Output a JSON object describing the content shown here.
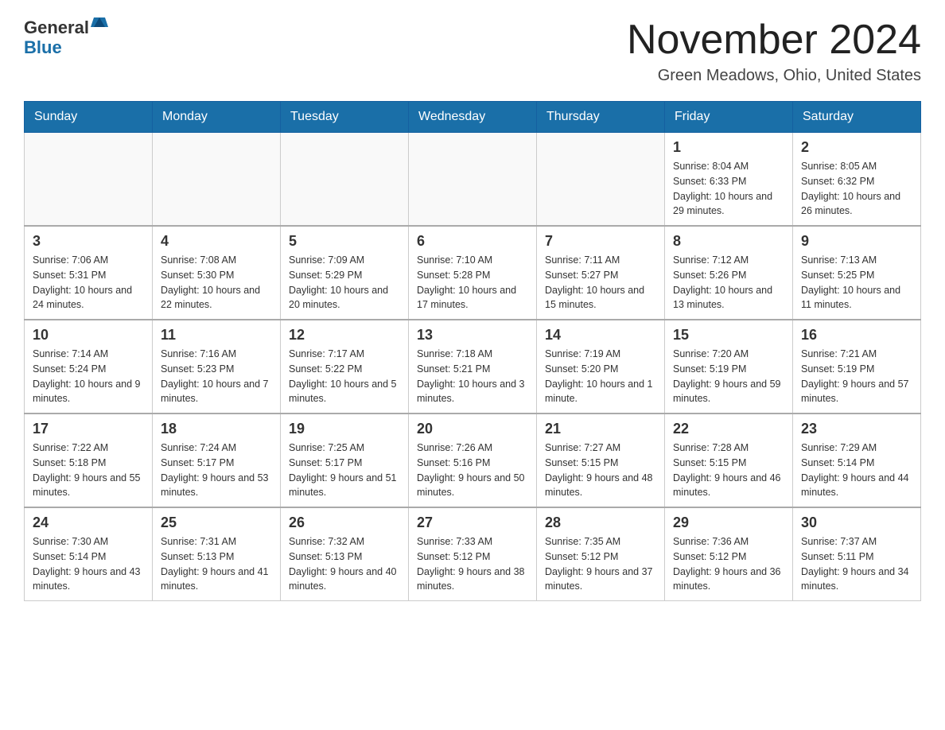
{
  "header": {
    "logo_general": "General",
    "logo_blue": "Blue",
    "title": "November 2024",
    "location": "Green Meadows, Ohio, United States"
  },
  "days_of_week": [
    "Sunday",
    "Monday",
    "Tuesday",
    "Wednesday",
    "Thursday",
    "Friday",
    "Saturday"
  ],
  "weeks": [
    [
      {
        "day": "",
        "info": ""
      },
      {
        "day": "",
        "info": ""
      },
      {
        "day": "",
        "info": ""
      },
      {
        "day": "",
        "info": ""
      },
      {
        "day": "",
        "info": ""
      },
      {
        "day": "1",
        "info": "Sunrise: 8:04 AM\nSunset: 6:33 PM\nDaylight: 10 hours and 29 minutes."
      },
      {
        "day": "2",
        "info": "Sunrise: 8:05 AM\nSunset: 6:32 PM\nDaylight: 10 hours and 26 minutes."
      }
    ],
    [
      {
        "day": "3",
        "info": "Sunrise: 7:06 AM\nSunset: 5:31 PM\nDaylight: 10 hours and 24 minutes."
      },
      {
        "day": "4",
        "info": "Sunrise: 7:08 AM\nSunset: 5:30 PM\nDaylight: 10 hours and 22 minutes."
      },
      {
        "day": "5",
        "info": "Sunrise: 7:09 AM\nSunset: 5:29 PM\nDaylight: 10 hours and 20 minutes."
      },
      {
        "day": "6",
        "info": "Sunrise: 7:10 AM\nSunset: 5:28 PM\nDaylight: 10 hours and 17 minutes."
      },
      {
        "day": "7",
        "info": "Sunrise: 7:11 AM\nSunset: 5:27 PM\nDaylight: 10 hours and 15 minutes."
      },
      {
        "day": "8",
        "info": "Sunrise: 7:12 AM\nSunset: 5:26 PM\nDaylight: 10 hours and 13 minutes."
      },
      {
        "day": "9",
        "info": "Sunrise: 7:13 AM\nSunset: 5:25 PM\nDaylight: 10 hours and 11 minutes."
      }
    ],
    [
      {
        "day": "10",
        "info": "Sunrise: 7:14 AM\nSunset: 5:24 PM\nDaylight: 10 hours and 9 minutes."
      },
      {
        "day": "11",
        "info": "Sunrise: 7:16 AM\nSunset: 5:23 PM\nDaylight: 10 hours and 7 minutes."
      },
      {
        "day": "12",
        "info": "Sunrise: 7:17 AM\nSunset: 5:22 PM\nDaylight: 10 hours and 5 minutes."
      },
      {
        "day": "13",
        "info": "Sunrise: 7:18 AM\nSunset: 5:21 PM\nDaylight: 10 hours and 3 minutes."
      },
      {
        "day": "14",
        "info": "Sunrise: 7:19 AM\nSunset: 5:20 PM\nDaylight: 10 hours and 1 minute."
      },
      {
        "day": "15",
        "info": "Sunrise: 7:20 AM\nSunset: 5:19 PM\nDaylight: 9 hours and 59 minutes."
      },
      {
        "day": "16",
        "info": "Sunrise: 7:21 AM\nSunset: 5:19 PM\nDaylight: 9 hours and 57 minutes."
      }
    ],
    [
      {
        "day": "17",
        "info": "Sunrise: 7:22 AM\nSunset: 5:18 PM\nDaylight: 9 hours and 55 minutes."
      },
      {
        "day": "18",
        "info": "Sunrise: 7:24 AM\nSunset: 5:17 PM\nDaylight: 9 hours and 53 minutes."
      },
      {
        "day": "19",
        "info": "Sunrise: 7:25 AM\nSunset: 5:17 PM\nDaylight: 9 hours and 51 minutes."
      },
      {
        "day": "20",
        "info": "Sunrise: 7:26 AM\nSunset: 5:16 PM\nDaylight: 9 hours and 50 minutes."
      },
      {
        "day": "21",
        "info": "Sunrise: 7:27 AM\nSunset: 5:15 PM\nDaylight: 9 hours and 48 minutes."
      },
      {
        "day": "22",
        "info": "Sunrise: 7:28 AM\nSunset: 5:15 PM\nDaylight: 9 hours and 46 minutes."
      },
      {
        "day": "23",
        "info": "Sunrise: 7:29 AM\nSunset: 5:14 PM\nDaylight: 9 hours and 44 minutes."
      }
    ],
    [
      {
        "day": "24",
        "info": "Sunrise: 7:30 AM\nSunset: 5:14 PM\nDaylight: 9 hours and 43 minutes."
      },
      {
        "day": "25",
        "info": "Sunrise: 7:31 AM\nSunset: 5:13 PM\nDaylight: 9 hours and 41 minutes."
      },
      {
        "day": "26",
        "info": "Sunrise: 7:32 AM\nSunset: 5:13 PM\nDaylight: 9 hours and 40 minutes."
      },
      {
        "day": "27",
        "info": "Sunrise: 7:33 AM\nSunset: 5:12 PM\nDaylight: 9 hours and 38 minutes."
      },
      {
        "day": "28",
        "info": "Sunrise: 7:35 AM\nSunset: 5:12 PM\nDaylight: 9 hours and 37 minutes."
      },
      {
        "day": "29",
        "info": "Sunrise: 7:36 AM\nSunset: 5:12 PM\nDaylight: 9 hours and 36 minutes."
      },
      {
        "day": "30",
        "info": "Sunrise: 7:37 AM\nSunset: 5:11 PM\nDaylight: 9 hours and 34 minutes."
      }
    ]
  ]
}
